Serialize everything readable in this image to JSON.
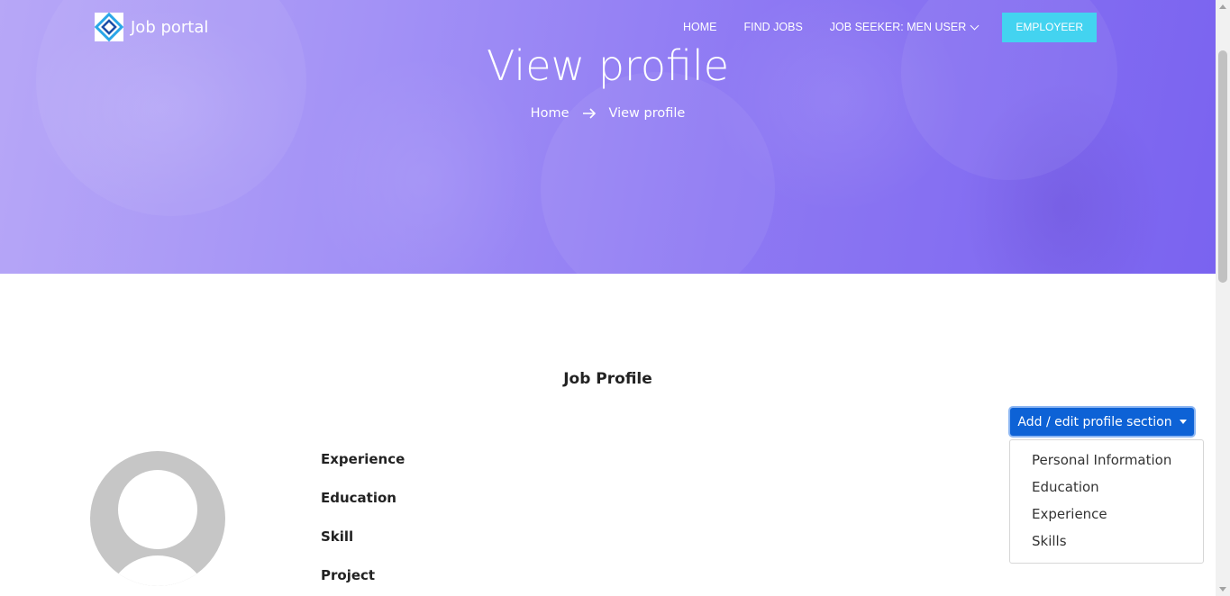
{
  "header": {
    "logo_text": "Job portal",
    "nav": [
      {
        "label": "HOME"
      },
      {
        "label": "FIND JOBS"
      },
      {
        "label": "JOB SEEKER: MEN USER"
      }
    ],
    "employer_button": "EMPLOYEER"
  },
  "hero": {
    "title": "View profile",
    "breadcrumb": {
      "home": "Home",
      "current": "View profile"
    }
  },
  "profile": {
    "section_title": "Job Profile",
    "edit_button": "Add / edit profile section",
    "dropdown_options": [
      "Personal Information",
      "Education",
      "Experience",
      "Skills"
    ],
    "sections": [
      "Experience",
      "Education",
      "Skill",
      "Project"
    ]
  },
  "colors": {
    "hero_start": "#b7a7f7",
    "hero_end": "#7a63f0",
    "employer_button": "#43d3f0",
    "edit_button": "#0d62d6"
  },
  "icons": [
    "logo-icon",
    "chevron-down-icon",
    "arrow-right-icon",
    "caret-down-icon",
    "avatar-icon"
  ]
}
